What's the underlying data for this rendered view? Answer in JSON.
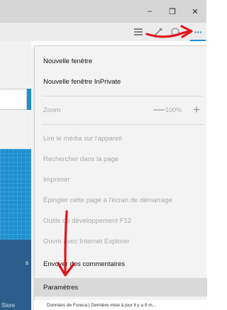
{
  "window": {
    "minimize_glyph": "–",
    "maximize_glyph": "❐",
    "close_glyph": "✕"
  },
  "toolbar": {
    "hub_icon": "hub-lines-icon",
    "note_icon": "web-note-icon",
    "share_icon": "share-icon",
    "more_glyph": "···"
  },
  "menu": {
    "new_window": "Nouvelle fenêtre",
    "new_inprivate": "Nouvelle fenêtre InPrivate",
    "zoom_label": "Zoom",
    "zoom_value": "100%",
    "zoom_minus": "—",
    "zoom_plus": "+",
    "cast_media": "Lire le média sur l'appareil",
    "find_on_page": "Rechercher dans la page",
    "print": "Imprimer",
    "pin_to_start": "Épingler cette page à l'écran de démarrage",
    "dev_tools": "Outils de développement F12",
    "open_ie": "Ouvrir avec Internet Explorer",
    "send_feedback": "Envoyer des commentaires",
    "settings": "Paramètres"
  },
  "status": {
    "text": "Données de Foreca | Dernière mise à jour il y a 9 m..."
  },
  "background_page": {
    "store_label": "Store",
    "side_text": "s"
  },
  "colors": {
    "tile_blue": "#1e8fd0",
    "annotation_red": "#e0161b",
    "more_button_blue": "#1e8fd0"
  }
}
